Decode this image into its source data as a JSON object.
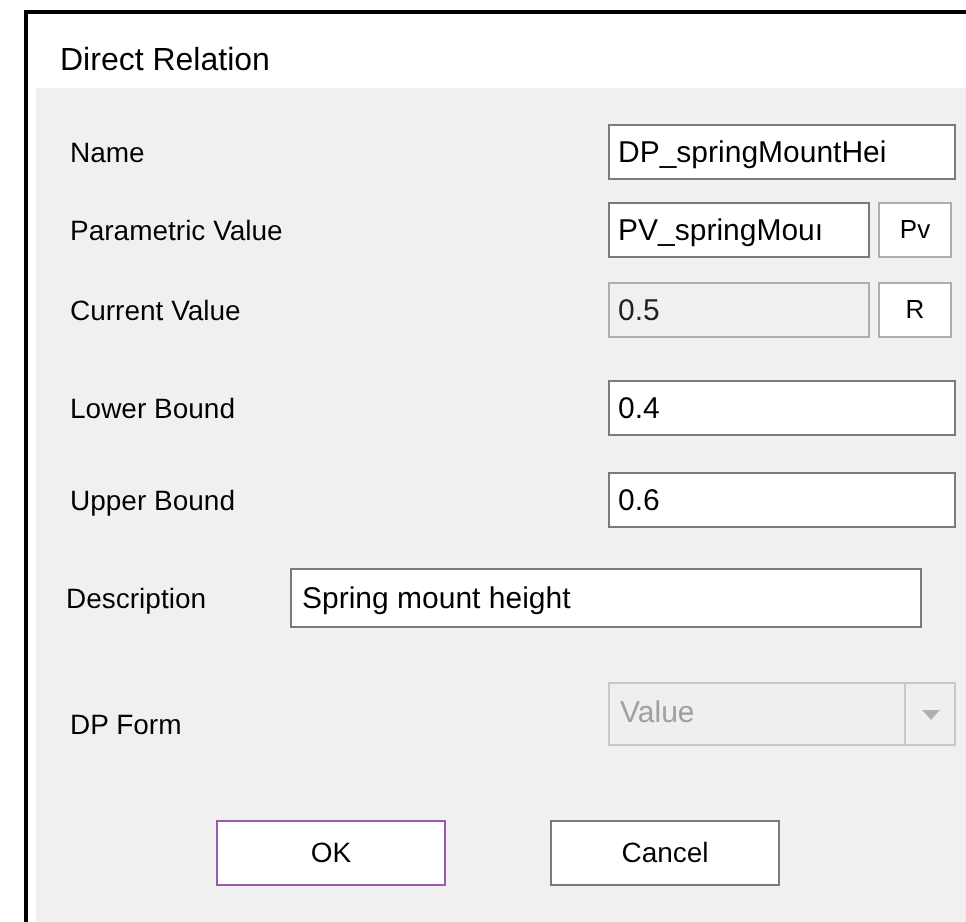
{
  "window": {
    "title": "Direct Relation"
  },
  "fields": [
    {
      "kind": "text",
      "label": "Name",
      "value": "DP_springMountHei",
      "disabled": false
    },
    {
      "kind": "text_button",
      "label": "Parametric Value",
      "value": "PV_springMouı",
      "button": "Pv",
      "disabled": false
    },
    {
      "kind": "text_button",
      "label": "Current Value",
      "value": "0.5",
      "button": "R",
      "disabled": true
    },
    {
      "kind": "text",
      "label": "Lower Bound",
      "value": "0.4",
      "disabled": false
    },
    {
      "kind": "text",
      "label": "Upper Bound",
      "value": "0.6",
      "disabled": false
    },
    {
      "kind": "wide",
      "label": "Description",
      "value": "Spring mount height",
      "disabled": false
    },
    {
      "kind": "dropdown",
      "label": "DP Form",
      "value": "Value",
      "disabled": true
    }
  ],
  "buttons": [
    {
      "label": "OK",
      "focused": true
    },
    {
      "label": "Cancel",
      "focused": false
    }
  ]
}
